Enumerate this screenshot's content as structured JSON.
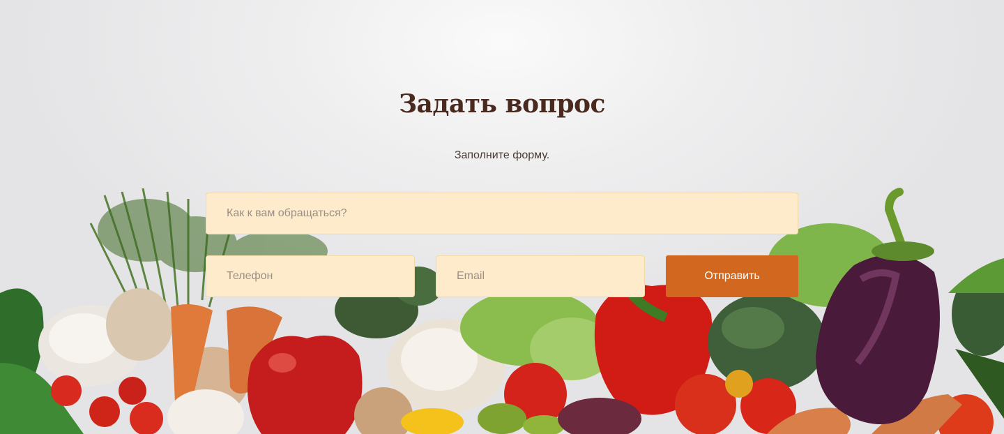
{
  "form": {
    "title": "Задать вопрос",
    "subtitle": "Заполните форму.",
    "name_placeholder": "Как к вам обращаться?",
    "phone_placeholder": "Телефон",
    "email_placeholder": "Email",
    "submit_label": "Отправить"
  },
  "colors": {
    "title": "#4a2a1f",
    "input_background": "#fdebcb",
    "button_background": "#d2671f",
    "button_text": "#ffffff"
  }
}
